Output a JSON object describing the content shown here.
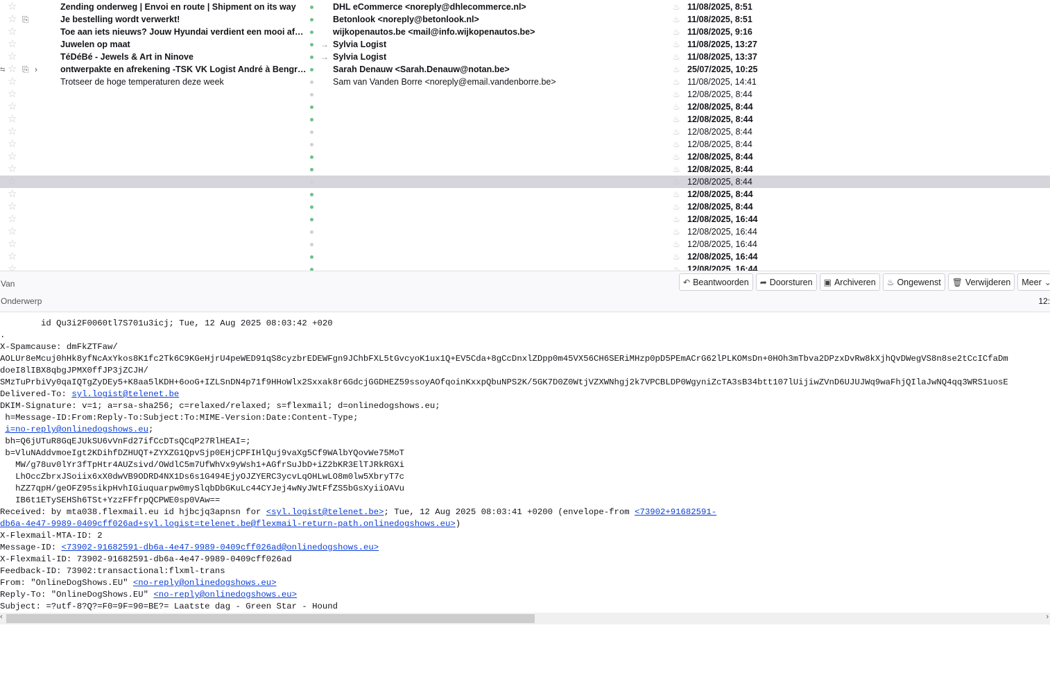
{
  "messages": [
    {
      "subject": "Zending onderweg | Envoi en route | Shipment on its way",
      "from": "DHL eCommerce <noreply@dhlecommerce.nl>",
      "date": "11/08/2025, 8:51",
      "unread": true
    },
    {
      "subject": "Je bestelling wordt verwerkt!",
      "from": "Betonlook <noreply@betonlook.nl>",
      "date": "11/08/2025, 8:51",
      "unread": true,
      "attachment": true
    },
    {
      "subject": "Toe aan iets nieuws? Jouw Hyundai verdient een mooi afsch...",
      "from": "wijkopenautos.be <mail@info.wijkopenautos.be>",
      "date": "11/08/2025, 9:16",
      "unread": true
    },
    {
      "subject": "Juwelen op maat",
      "from": "Sylvia Logist",
      "date": "11/08/2025, 13:27",
      "unread": true,
      "forwarded": true
    },
    {
      "subject": "TéDéBé - Jewels & Art in Ninove",
      "from": "Sylvia Logist",
      "date": "11/08/2025, 13:37",
      "unread": true,
      "forwarded": true
    },
    {
      "subject": "ontwerpakte en afrekening -TSK VK Logist André à Bengrad ...",
      "from": "Sarah Denauw <Sarah.Denauw@notan.be>",
      "date": "25/07/2025, 10:25",
      "unread": true,
      "attachment": true,
      "thread": true
    },
    {
      "subject": "Trotseer de hoge temperaturen deze week",
      "from": "Sam van Vanden Borre <noreply@email.vandenborre.be>",
      "date": "11/08/2025, 14:41",
      "unread": false
    },
    {
      "subject": "",
      "from": "",
      "date": "12/08/2025, 8:44",
      "unread": false
    },
    {
      "subject": "",
      "from": "",
      "date": "12/08/2025, 8:44",
      "unread": true
    },
    {
      "subject": "",
      "from": "",
      "date": "12/08/2025, 8:44",
      "unread": true
    },
    {
      "subject": "",
      "from": "",
      "date": "12/08/2025, 8:44",
      "unread": false
    },
    {
      "subject": "",
      "from": "",
      "date": "12/08/2025, 8:44",
      "unread": false
    },
    {
      "subject": "",
      "from": "",
      "date": "12/08/2025, 8:44",
      "unread": true
    },
    {
      "subject": "",
      "from": "",
      "date": "12/08/2025, 8:44",
      "unread": true
    },
    {
      "subject": "",
      "from": "",
      "date": "12/08/2025, 8:44",
      "unread": false,
      "selected": true
    },
    {
      "subject": "",
      "from": "",
      "date": "12/08/2025, 8:44",
      "unread": true
    },
    {
      "subject": "",
      "from": "",
      "date": "12/08/2025, 8:44",
      "unread": true
    },
    {
      "subject": "",
      "from": "",
      "date": "12/08/2025, 16:44",
      "unread": true
    },
    {
      "subject": "",
      "from": "",
      "date": "12/08/2025, 16:44",
      "unread": false
    },
    {
      "subject": "",
      "from": "",
      "date": "12/08/2025, 16:44",
      "unread": false
    },
    {
      "subject": "",
      "from": "",
      "date": "12/08/2025, 16:44",
      "unread": true
    },
    {
      "subject": "",
      "from": "",
      "date": "12/08/2025, 16:44",
      "unread": true
    }
  ],
  "header": {
    "from_label": "Van",
    "subject_label": "Onderwerp",
    "time": "12:",
    "buttons": {
      "reply": "Beantwoorden",
      "forward": "Doorsturen",
      "archive": "Archiveren",
      "junk": "Ongewenst",
      "delete": "Verwijderen",
      "more": "Meer"
    }
  },
  "source": [
    [
      {
        "t": "        id Qu3i2F0060tl7S701u3icj; Tue, 12 Aug 2025 08:03:42 +020"
      }
    ],
    [
      {
        "t": "."
      }
    ],
    [
      {
        "t": "X-Spamcause: dmFkZTFaw/"
      }
    ],
    [
      {
        "t": "AOLUr8eMcuj0hHk8yfNcAxYkos8K1fc2Tk6C9KGeHjrU4peWED91qS8cyzbrEDEWFgn9JChbFXL5tGvcyoK1ux1Q+EV5Cda+8gCcDnxlZDpp0m45VX56CH6SERiMHzp0pD5PEmACrG62lPLKOMsDn+0HOh3mTbva2DPzxDvRw8kXjhQvDWegVS8n8se2tCcICfaDm"
      }
    ],
    [
      {
        "t": "doeI8lIBX8qbgJPMX0ffJP3jZCJH/"
      }
    ],
    [
      {
        "t": "SMzTuPrbiVy0qaIQTgZyDEy5+K8aa5lKDH+6ooG+IZLSnDN4p71f9HHoWlx2Sxxak8r6GdcjGGDHEZ59ssoyAOfqoinKxxpQbuNPS2K/5GK7D0Z0WtjVZXWNhgj2k7VPCBLDP0WgyniZcTA3sB34btt107lUijiwZVnD6UJUJWq9waFhjQIlaJwNQ4qq3WRS1uosE"
      }
    ],
    [
      {
        "t": "Delivered-To: "
      },
      {
        "t": "syl.logist@telenet.be",
        "link": true
      }
    ],
    [
      {
        "t": "DKIM-Signature: v=1; a=rsa-sha256; c=relaxed/relaxed; s=flexmail; d=onlinedogshows.eu;"
      }
    ],
    [
      {
        "t": " h=Message-ID:From:Reply-To:Subject:To:MIME-Version:Date:Content-Type;"
      }
    ],
    [
      {
        "t": " "
      },
      {
        "t": "i=no-reply@onlinedogshows.eu",
        "link": true
      },
      {
        "t": ";"
      }
    ],
    [
      {
        "t": " bh=Q6jUTuR8GqEJUkSU6vVnFd27ifCcDTsQCqP27RlHEAI=;"
      }
    ],
    [
      {
        "t": " b=VluNAddvmoeIgt2KDihfDZHUQT+ZYXZG1QpvSjp0EHjCPFIHlQuj9vaXg5Cf9WAlbYQovWe75MoT"
      }
    ],
    [
      {
        "t": "   MW/g78uv0lYr3fTpHtr4AUZsivd/OWdlC5m7UfWhVx9yWsh1+AGfrSuJbD+iZ2bKR3ElTJRkRGXi"
      }
    ],
    [
      {
        "t": "   LhOccZbrxJSoiix6xX0dwVB9ODRD4NX1Ds6s1G494EjyOJZYERC3ycvLqOHLwLO8m0lw5XbryT7c"
      }
    ],
    [
      {
        "t": "   hZZ7qpH/geOFZ95sikpHvhIGiuquarpw0mySlqbDbGKuLc44CYJej4wNyJWtFfZS5bGsXyiiOAVu"
      }
    ],
    [
      {
        "t": "   IB6t1ETySEHSh6TSt+YzzFFfrpQCPWE0sp0VAw=="
      }
    ],
    [
      {
        "t": "Received: by mta038.flexmail.eu id hjbcjq3apnsn for "
      },
      {
        "t": "<syl.logist@telenet.be>",
        "link": true
      },
      {
        "t": "; Tue, 12 Aug 2025 08:03:41 +0200 (envelope-from "
      },
      {
        "t": "<73902+91682591-",
        "link": true
      }
    ],
    [
      {
        "t": "db6a-4e47-9989-0409cff026ad+syl.logist=telenet.be@flexmail-return-path.onlinedogshows.eu>",
        "link": true
      },
      {
        "t": ")"
      }
    ],
    [
      {
        "t": "X-Flexmail-MTA-ID: 2"
      }
    ],
    [
      {
        "t": "Message-ID: "
      },
      {
        "t": "<73902-91682591-db6a-4e47-9989-0409cff026ad@onlinedogshows.eu>",
        "link": true
      }
    ],
    [
      {
        "t": "X-Flexmail-ID: 73902-91682591-db6a-4e47-9989-0409cff026ad"
      }
    ],
    [
      {
        "t": "Feedback-ID: 73902:transactional:flxml-trans"
      }
    ],
    [
      {
        "t": "From: \"OnlineDogShows.EU\" "
      },
      {
        "t": "<no-reply@onlinedogshows.eu>",
        "link": true
      }
    ],
    [
      {
        "t": "Reply-To: \"OnlineDogShows.EU\" "
      },
      {
        "t": "<no-reply@onlinedogshows.eu>",
        "link": true
      }
    ],
    [
      {
        "t": "Subject: =?utf-8?Q?=F0=9F=90=BE?= Laatste dag - Green Star - Hound"
      }
    ]
  ]
}
